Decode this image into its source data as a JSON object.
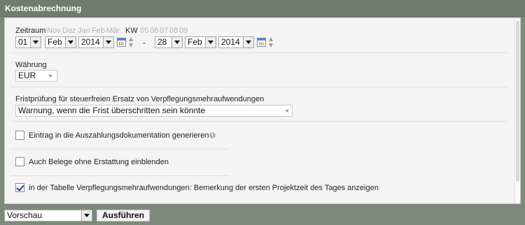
{
  "panel": {
    "title": "Kostenabrechnung"
  },
  "period": {
    "label": "Zeitraum",
    "months": [
      "Nov",
      "Dez",
      "Jan",
      "Feb",
      "Mär"
    ],
    "kw_label": "KW",
    "weeks": [
      "05",
      "06",
      "07",
      "08",
      "09"
    ],
    "from": {
      "day": "01",
      "month": "Feb",
      "year": "2014"
    },
    "separator": "-",
    "to": {
      "day": "28",
      "month": "Feb",
      "year": "2014"
    }
  },
  "currency": {
    "label": "Währung",
    "value": "EUR"
  },
  "deadline": {
    "label": "Fristprüfung für steuerfreien Ersatz von Verpflegungsmehraufwendungen",
    "value": "Warnung, wenn die Frist überschritten sein könnte"
  },
  "options": [
    {
      "label": "Eintrag in die Auszahlungsdokumentation generieren",
      "checked": false,
      "info_icon": "info-icon"
    },
    {
      "label": "Auch Belege ohne Erstattung einblenden",
      "checked": false
    },
    {
      "label": "in der Tabelle Verpflegungsmehraufwendungen: Bemerkung der ersten Projektzeit des Tages anzeigen",
      "checked": true
    }
  ],
  "footer": {
    "output_select": "Vorschau",
    "run_button": "Ausführen"
  },
  "colors": {
    "frame": "#7e8a7d",
    "title_bar": "#6f7c6f",
    "content_bg": "#f4f4f4",
    "checkmark": "#2a3a9a"
  }
}
